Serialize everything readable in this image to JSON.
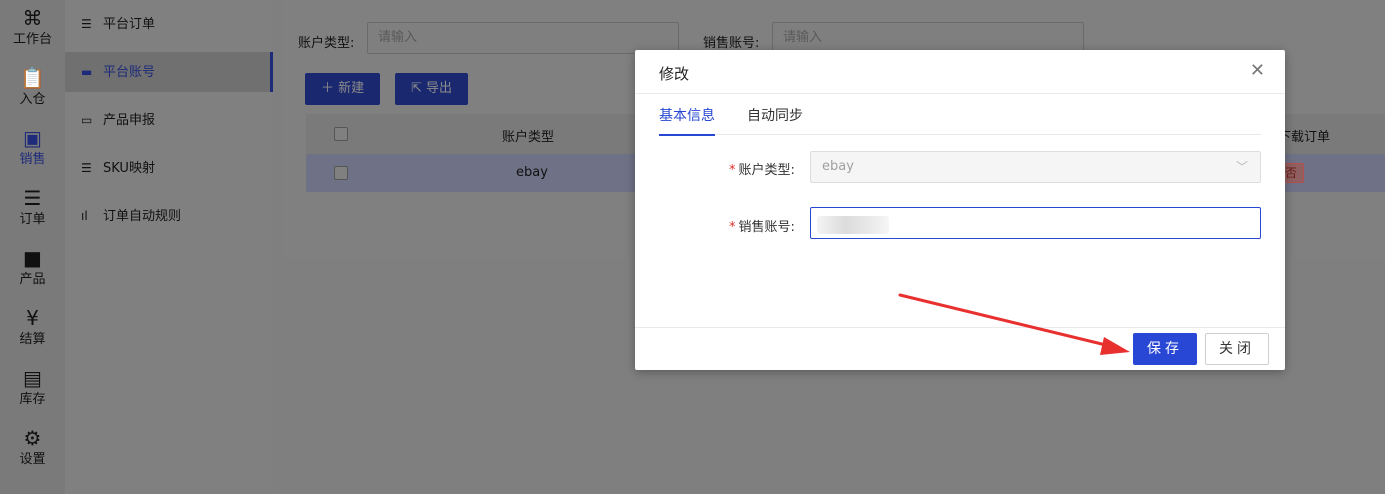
{
  "rail": [
    {
      "label": "工作台",
      "icon": "grid-icon"
    },
    {
      "label": "入仓",
      "icon": "clipboard-icon"
    },
    {
      "label": "销售",
      "icon": "sales-icon",
      "active": true
    },
    {
      "label": "订单",
      "icon": "order-icon"
    },
    {
      "label": "产品",
      "icon": "bag-icon"
    },
    {
      "label": "结算",
      "icon": "yen-icon"
    },
    {
      "label": "库存",
      "icon": "storage-icon"
    },
    {
      "label": "设置",
      "icon": "gear-icon"
    }
  ],
  "menu": [
    {
      "label": "平台订单",
      "icon": "list-icon"
    },
    {
      "label": "平台账号",
      "icon": "card-icon",
      "active": true
    },
    {
      "label": "产品申报",
      "icon": "monitor-icon"
    },
    {
      "label": "SKU映射",
      "icon": "list-icon"
    },
    {
      "label": "订单自动规则",
      "icon": "bars-icon"
    }
  ],
  "filters": {
    "account_type_label": "账户类型:",
    "account_type_placeholder": "请输入",
    "sales_account_label": "销售账号:",
    "sales_account_placeholder": "请输入"
  },
  "toolbar": {
    "new_label": "新建",
    "export_label": "导出"
  },
  "table": {
    "col_account_type": "账户类型",
    "col_download_orders": "下载订单",
    "row": {
      "account_type": "ebay",
      "download_orders": "否"
    }
  },
  "modal": {
    "title": "修改",
    "tabs": [
      "基本信息",
      "自动同步"
    ],
    "account_type_label": "账户类型:",
    "account_type_value": "ebay",
    "sales_account_label": "销售账号:",
    "save_label": "保存",
    "close_label": "关闭"
  },
  "colors": {
    "primary": "#2747d4",
    "required": "#e0302b",
    "arrow": "#e8312f"
  }
}
